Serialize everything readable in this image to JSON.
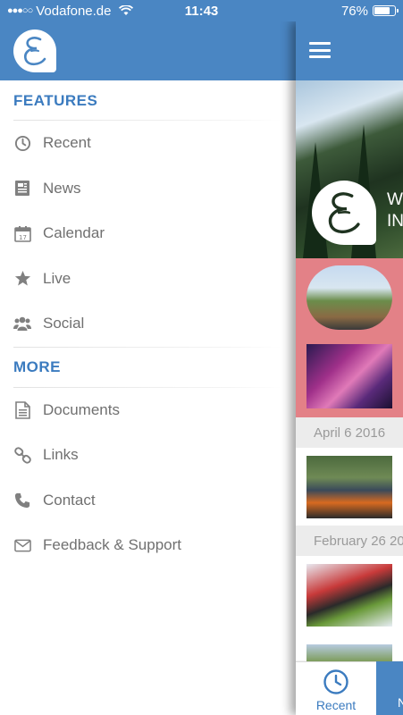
{
  "status_bar": {
    "carrier": "Vodafone.de",
    "time": "11:43",
    "battery_text": "76%",
    "battery_level": 0.76
  },
  "drawer": {
    "logo_icon": "e-script-logo",
    "sections": [
      {
        "title": "FEATURES",
        "items": [
          {
            "label": "Recent",
            "icon": "clock-icon"
          },
          {
            "label": "News",
            "icon": "newspaper-icon"
          },
          {
            "label": "Calendar",
            "icon": "calendar-icon"
          },
          {
            "label": "Live",
            "icon": "star-icon"
          },
          {
            "label": "Social",
            "icon": "people-icon"
          }
        ]
      },
      {
        "title": "MORE",
        "items": [
          {
            "label": "Documents",
            "icon": "document-icon"
          },
          {
            "label": "Links",
            "icon": "link-icon"
          },
          {
            "label": "Contact",
            "icon": "phone-icon"
          },
          {
            "label": "Feedback & Support",
            "icon": "mail-icon"
          }
        ]
      }
    ]
  },
  "main": {
    "hero_text_line1": "W",
    "hero_text_line2": "IN",
    "dates": [
      "April 6 2016",
      "February 26 20"
    ],
    "tabs": [
      {
        "label": "Recent",
        "icon": "clock-icon",
        "active": true
      },
      {
        "label": "N",
        "active": false
      }
    ]
  },
  "colors": {
    "brand_blue": "#4a86c3",
    "section_blue": "#3b7bbf",
    "featured_pink": "#e38187",
    "menu_text": "#707070"
  }
}
